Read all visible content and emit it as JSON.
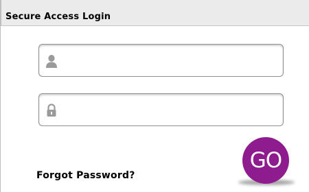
{
  "header": {
    "title": "Secure Access Login"
  },
  "username_field": {
    "icon": "user-icon",
    "value": "",
    "placeholder": ""
  },
  "password_field": {
    "icon": "lock-icon",
    "value": "",
    "placeholder": ""
  },
  "forgot_password": {
    "label": "Forgot Password?"
  },
  "go_button": {
    "label": "GO",
    "color": "#8e1c8e"
  }
}
